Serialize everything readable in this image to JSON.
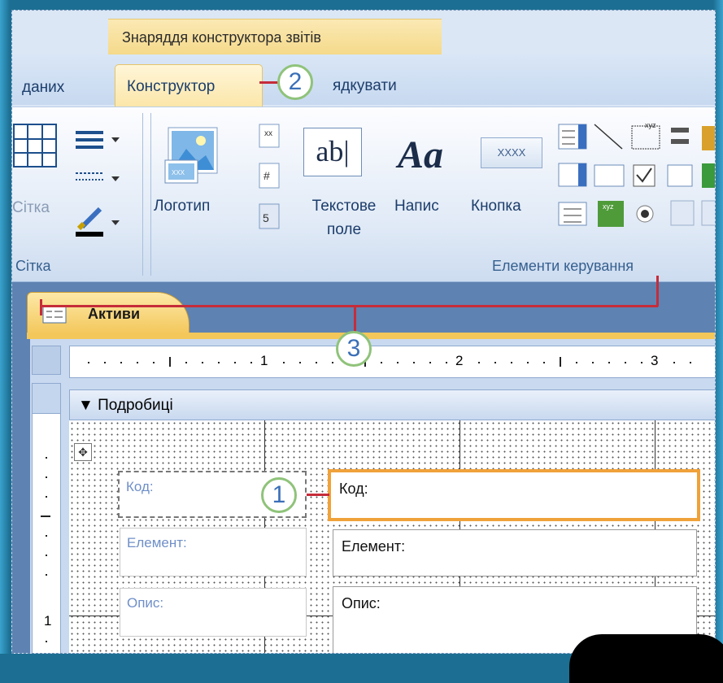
{
  "ribbon": {
    "contextual_group": "Знаряддя конструктора звітів",
    "tabs": {
      "data_partial": "даних",
      "design": "Конструктор",
      "arrange_partial": "ядкувати"
    },
    "grid_group": {
      "button_label_partial": "Сітка",
      "group_label": "Сітка"
    },
    "controls_group": {
      "logo_label": "Логотип",
      "textbox_label_1": "Текстове",
      "textbox_label_2": "поле",
      "label_label": "Напис",
      "button_label": "Кнопка",
      "button_icon_text": "XXXX",
      "textbox_icon_text": "ab|",
      "label_icon_text": "Aa",
      "group_label": "Елементи керування"
    }
  },
  "document": {
    "tab_title": "Активи",
    "section_title": "Подробиці",
    "ruler_numbers": [
      "1",
      "2",
      "3"
    ],
    "vruler_number": "1",
    "fields": [
      {
        "label": "Код:",
        "control": "Код:"
      },
      {
        "label": "Елемент:",
        "control": "Елемент:"
      },
      {
        "label": "Опис:",
        "control": "Опис:"
      }
    ]
  },
  "callouts": [
    "1",
    "2",
    "3"
  ],
  "colors": {
    "accent_orange": "#f0a23a",
    "callout_border": "#8fc37a",
    "callout_text": "#3b6fb8",
    "leader_line": "#c62c3a"
  }
}
